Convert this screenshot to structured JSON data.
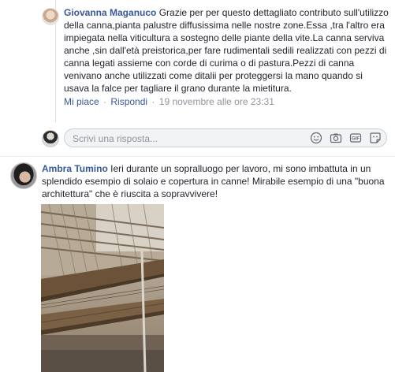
{
  "reply": {
    "author": "Giovanna Maganuco",
    "text": "Grazie per per questo dettagliato contributo sull'utilizzo della canna,pianta palustre diffusissima nelle nostre zone.Essa ,tra l'altro era impiegata nella viticultura a sostegno delle piante della vite.La canna serviva anche ,sin dall'età preistorica,per fare rudimentali sedili realizzati con pezzi di canna legati assieme con corde di curima o di pastura.Pezzi di canna venivano anche utilizzati come ditalii per proteggersi la mano quando si usava la falce per tagliare il grano durante la mietitura.",
    "like_label": "Mi piace",
    "reply_label": "Rispondi",
    "timestamp": "19 novembre alle ore 23:31"
  },
  "compose": {
    "placeholder": "Scrivi una risposta...",
    "icons": [
      "emoji-icon",
      "camera-icon",
      "gif-icon",
      "sticker-icon"
    ]
  },
  "comment": {
    "author": "Ambra Tumino",
    "text": "Ieri durante un sopralluogo per lavoro, mi sono imbattuta in un splendido esempio di solaio e copertura in canne! Mirabile esempio di una \"buona architettura\" che è riuscita a sopravvivere!"
  },
  "colors": {
    "author_link": "#385898",
    "meta_gray": "#90949c",
    "compose_bg": "#f2f3f5",
    "divider": "#e9ebee"
  }
}
